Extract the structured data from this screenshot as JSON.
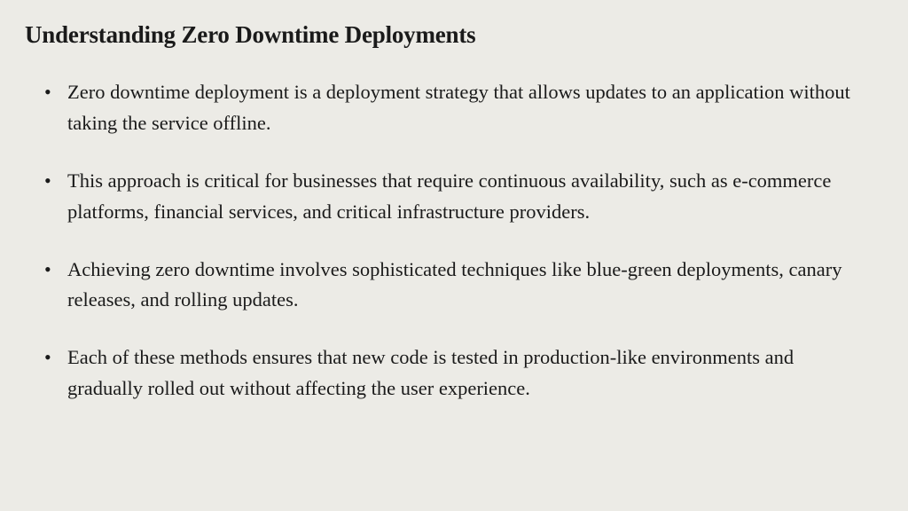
{
  "title": "Understanding Zero Downtime Deployments",
  "bullets": [
    "Zero downtime deployment is a deployment strategy that allows updates to an application without taking the service offline.",
    "This approach is critical for businesses that require continuous availability, such as e-commerce platforms, financial services, and critical infrastructure providers.",
    " Achieving zero downtime involves sophisticated techniques like blue-green deployments, canary releases, and rolling updates.",
    "Each of these methods ensures that new code is tested in production-like environments and gradually rolled out without affecting the user experience."
  ]
}
